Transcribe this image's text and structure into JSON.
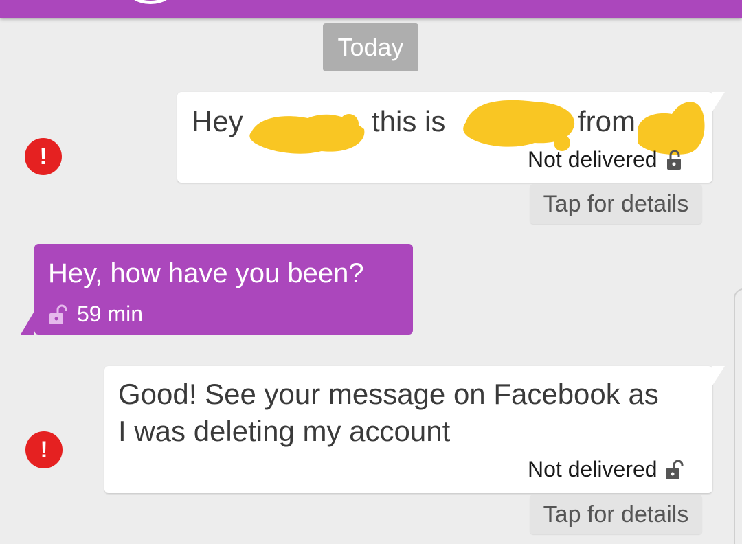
{
  "header": {
    "accent_color": "#ab47bc"
  },
  "date_chip": {
    "label": "Today"
  },
  "messages": [
    {
      "direction": "outgoing",
      "text_parts": [
        "Hey",
        "this is",
        "from"
      ],
      "redacted": true,
      "status": "Not delivered",
      "status_icon": "lock-icon",
      "error_icon": "error-exclamation-icon",
      "error_symbol": "!",
      "details_label": "Tap for details"
    },
    {
      "direction": "incoming",
      "text": "Hey, how have you been?",
      "time": "59 min",
      "status_icon": "unlocked-lock-icon"
    },
    {
      "direction": "outgoing",
      "text_lines": [
        "Good! See your message on Facebook as",
        "I was deleting my account"
      ],
      "status": "Not delivered",
      "status_icon": "unlocked-lock-icon",
      "error_icon": "error-exclamation-icon",
      "error_symbol": "!",
      "details_label": "Tap for details"
    }
  ],
  "colors": {
    "outgoing_bubble": "#ffffff",
    "incoming_bubble": "#ab47bc",
    "error": "#e52121",
    "redaction": "#f9c623",
    "background": "#ededed"
  }
}
